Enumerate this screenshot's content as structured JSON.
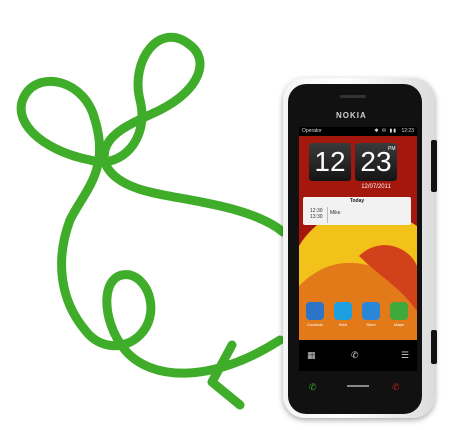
{
  "colors": {
    "scribble": "#3fad2a",
    "screen_accent": "#d1421a"
  },
  "phone": {
    "brand": "NOKIA",
    "statusbar": {
      "operator": "Operator",
      "icons": "✱ ✉ ▮▮",
      "time": "12:23"
    },
    "clock": {
      "hours": "12",
      "minutes": "23",
      "ampm": "PM",
      "date": "12/07/2011"
    },
    "agenda": {
      "title": "Today",
      "time_line1": "12:30",
      "time_line2": "13:30",
      "entry": "Mike"
    },
    "apps": [
      {
        "label": "Contacts",
        "color": "#2b74c8"
      },
      {
        "label": "Web",
        "color": "#1d9fe0"
      },
      {
        "label": "Store",
        "color": "#2a86d6"
      },
      {
        "label": "Maps",
        "color": "#41a83c"
      }
    ],
    "bottombar": {
      "grid_icon": "▦",
      "call_icon": "✆",
      "menu_icon": "☰"
    }
  }
}
